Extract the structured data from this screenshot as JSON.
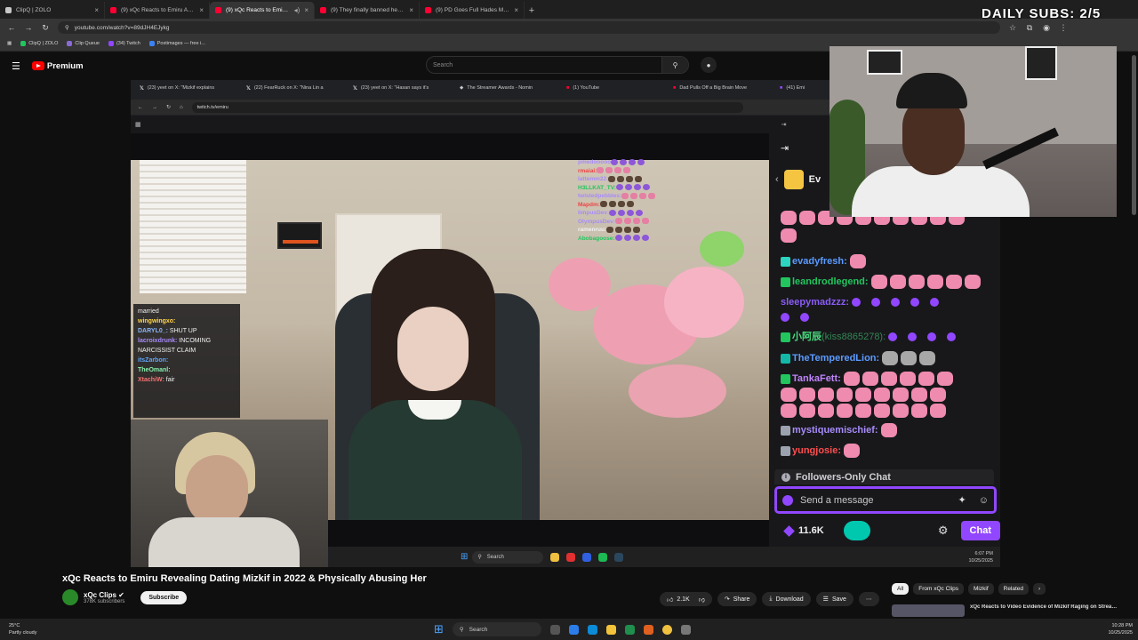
{
  "browser": {
    "tabs": [
      {
        "title": "ClipQ | ZOLO",
        "yt": false
      },
      {
        "title": "(9) xQc Reacts to Emiru Accusing",
        "yt": true
      },
      {
        "title": "(9) xQc Reacts to Emiru Re",
        "yt": true,
        "active": true
      },
      {
        "title": "(9) They finally banned her. - Yo",
        "yt": true
      },
      {
        "title": "(9) PD Goes Full Hades Mode V",
        "yt": true
      }
    ],
    "url": "youtube.com/watch?v=89dJH4EJykg",
    "bookmarks": [
      "ClipQ | ZOLO",
      "Clip Queue",
      "(34) Twitch",
      "Postimages — free i..."
    ]
  },
  "youtube": {
    "brand": "Premium",
    "search_placeholder": "Search"
  },
  "inner_browser": {
    "tabs": [
      "(23) yeet on X: \"Mizkif explains",
      "(22) FearRuck on X: \"Nina Lin a",
      "(23) yeet on X: \"Hasan says it's",
      "The Streamer Awards - Nomin",
      "(1) YouTube",
      "Dad Pulls Off a Big Brain Move",
      "(41) Emi"
    ],
    "url": "twitch.tv/emiru"
  },
  "stream_overlay_chat": [
    {
      "name": "",
      "text": "married",
      "color": "#efeff1"
    },
    {
      "name": "wingwingxo:",
      "text": "",
      "color": "#ffd54a"
    },
    {
      "name": "DARYL0_:",
      "text": "SHUT UP",
      "color": "#8ab4f8"
    },
    {
      "name": "lacroixdrunk:",
      "text": "INCOMING NARCISSIST CLAIM",
      "color": "#a78bfa"
    },
    {
      "name": "itsZarbon:",
      "text": "",
      "color": "#60a5fa"
    },
    {
      "name": "TheOmanl:",
      "text": "",
      "color": "#86efac"
    },
    {
      "name": "XtachiW:",
      "text": "fair",
      "color": "#f87171"
    }
  ],
  "on_screen_chat": [
    {
      "name": "pmedooooo",
      "color": "#a78bfa"
    },
    {
      "name": "rmaiai:",
      "color": "#ef4444"
    },
    {
      "name": "lattemm22:",
      "color": "#a78bfa"
    },
    {
      "name": "H3LLKAT_TV:",
      "color": "#22c55e"
    },
    {
      "name": "twistedpebbles:",
      "color": "#a78bfa"
    },
    {
      "name": "Mapdm:",
      "color": "#ef4444"
    },
    {
      "name": "limpusDev:",
      "color": "#a78bfa"
    },
    {
      "name": "OlympusDev:",
      "color": "#a78bfa"
    },
    {
      "name": "ramenruu:",
      "color": "#f1f1f1"
    },
    {
      "name": "Abobagoose:",
      "color": "#22c55e"
    }
  ],
  "twitch_chat": {
    "header": "Ev",
    "messages": [
      {
        "name": "evadyfresh:",
        "text": "",
        "color": "#5b9bff",
        "emotes": 1
      },
      {
        "name": "leandrodlegend:",
        "text": "",
        "color": "#22c55e",
        "emotes": 6
      },
      {
        "name": "sleepymadzzz:",
        "text": "",
        "color": "#8b5cf6",
        "emotes": 5
      },
      {
        "name": "小阿辰",
        "sub": "(kiss8865278):",
        "text": "",
        "color": "#4ade80",
        "emotes": 4
      },
      {
        "name": "TheTemperedLion:",
        "text": "",
        "color": "#5b9bff",
        "emotes": 3
      },
      {
        "name": "TankaFett:",
        "text": "",
        "color": "#c084fc",
        "emotes": 6
      },
      {
        "name": "mystiquemischief:",
        "text": "",
        "color": "#a78bfa",
        "emotes": 1
      },
      {
        "name": "yungjosie:",
        "text": "",
        "color": "#ff4d4d",
        "emotes": 1
      }
    ],
    "followers_only": "Followers-Only Chat",
    "send_placeholder": "Send a message",
    "points": "11.6K",
    "chat_button": "Chat"
  },
  "inner_taskbar": {
    "search": "Search",
    "time": "6:07 PM",
    "date": "10/25/2025"
  },
  "overlay": {
    "daily_subs": "DAILY SUBS: 2/5"
  },
  "video": {
    "title": "xQc Reacts to Emiru Revealing Dating Mizkif in 2022 & Physically Abusing Her",
    "channel": "xQc Clips",
    "subscribers": "378K subscribers",
    "subscribe": "Subscribe",
    "likes": "2.1K",
    "share": "Share",
    "download": "Download",
    "save": "Save"
  },
  "chips": [
    "All",
    "From xQc Clips",
    "Mizkif",
    "Related"
  ],
  "related_title": "xQc Reacts to Video Evidence of Mizkif Raging on Stream Spoiling",
  "taskbar": {
    "temp": "25°C",
    "weather": "Partly cloudy",
    "search": "Search",
    "time": "10:28 PM",
    "date": "10/25/2025"
  }
}
